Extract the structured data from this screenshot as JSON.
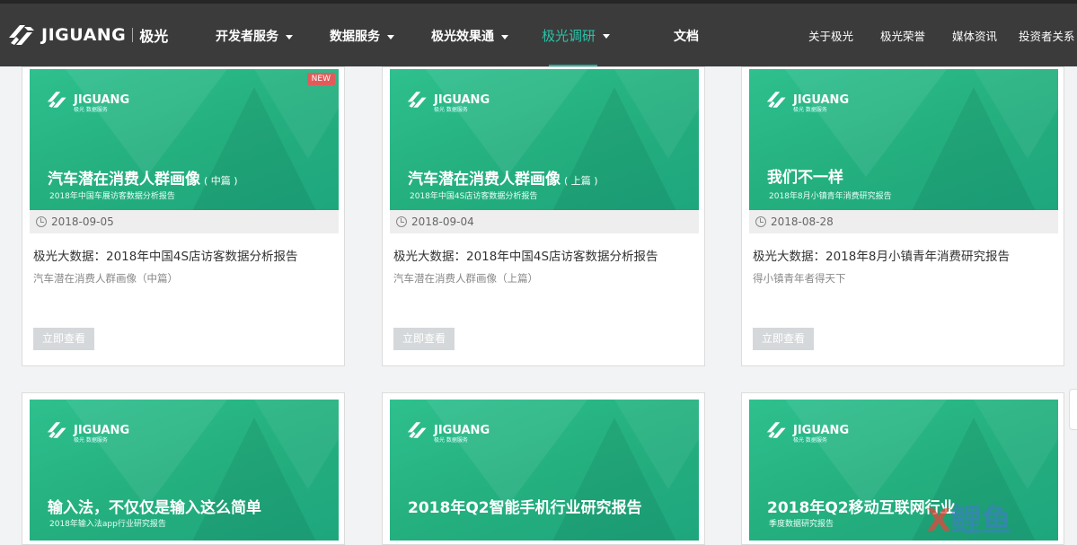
{
  "header": {
    "logo_text": "JIGUANG",
    "logo_cn": "极光",
    "nav": [
      {
        "label": "开发者服务"
      },
      {
        "label": "数据服务"
      },
      {
        "label": "极光效果通"
      },
      {
        "label": "极光调研"
      },
      {
        "label": "文档"
      }
    ],
    "right_nav": [
      {
        "label": "关于极光"
      },
      {
        "label": "极光荣誉"
      },
      {
        "label": "媒体资讯"
      },
      {
        "label": "投资者关系"
      }
    ],
    "active_nav": "极光调研"
  },
  "cards": [
    {
      "image_title": "汽车潜在消费人群画像",
      "image_title_suffix": "( 中篇 )",
      "image_subtitle": "2018年中国车展访客数据分析报告",
      "badge": "NEW",
      "date": "2018-09-05",
      "title": "极光大数据：2018年中国4S店访客数据分析报告",
      "desc": "汽车潜在消费人群画像（中篇）",
      "button": "立即查看"
    },
    {
      "image_title": "汽车潜在消费人群画像",
      "image_title_suffix": "( 上篇 )",
      "image_subtitle": "2018年中国4S店访客数据分析报告",
      "date": "2018-09-04",
      "title": "极光大数据：2018年中国4S店访客数据分析报告",
      "desc": "汽车潜在消费人群画像（上篇）",
      "button": "立即查看"
    },
    {
      "image_title": "我们不一样",
      "image_subtitle": "2018年8月小镇青年消费研究报告",
      "date": "2018-08-28",
      "title": "极光大数据：2018年8月小镇青年消费研究报告",
      "desc": "得小镇青年者得天下",
      "button": "立即查看"
    },
    {
      "image_title": "输入法，不仅仅是输入这么简单",
      "image_subtitle": "2018年输入法app行业研究报告"
    },
    {
      "image_title": "2018年Q2智能手机行业研究报告",
      "image_subtitle": ""
    },
    {
      "image_title": "2018年Q2移动互联网行业",
      "image_subtitle": "季度数据研究报告"
    }
  ],
  "image_logo_text": "JIGUANG",
  "image_logo_sub": "极光 数据服务",
  "watermark": {
    "x": "X",
    "text": "鲤鱼"
  },
  "colors": {
    "header_bg": "#3b3b3b",
    "accent": "#21b39c",
    "card_green": "#25b07f",
    "button_bg": "#d5d8da"
  }
}
